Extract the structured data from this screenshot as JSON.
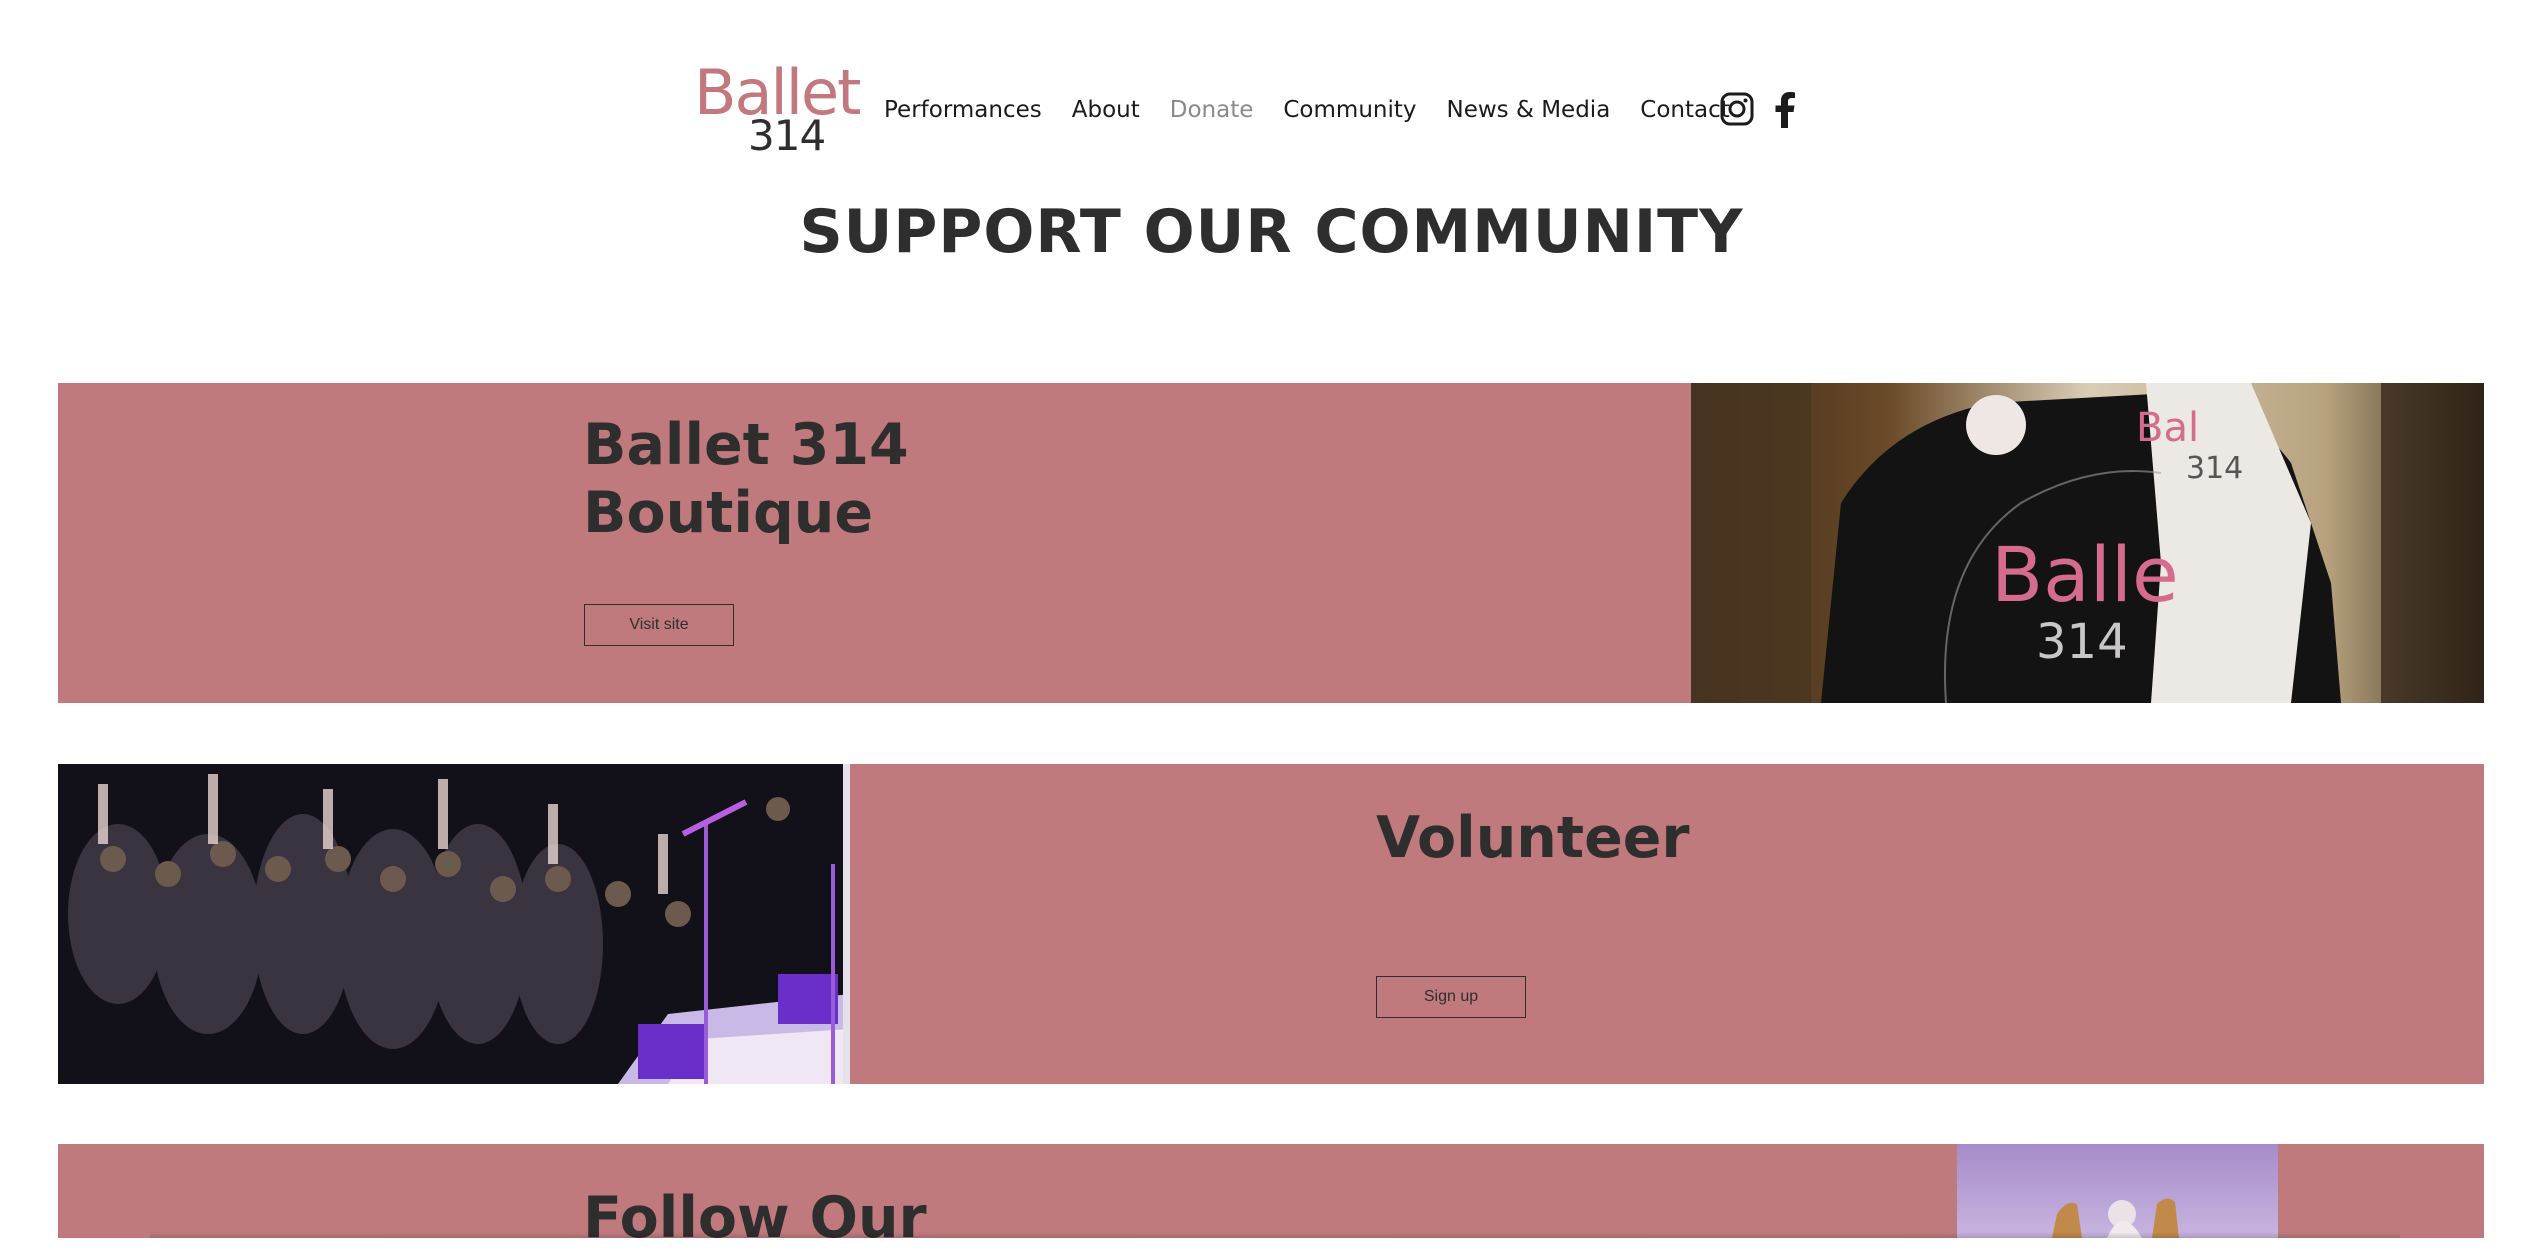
{
  "header": {
    "logo": {
      "line1": "Ballet",
      "line2": "314"
    },
    "nav": [
      {
        "label": "Performances",
        "active": false
      },
      {
        "label": "About",
        "active": false
      },
      {
        "label": "Donate",
        "active": true
      },
      {
        "label": "Community",
        "active": false
      },
      {
        "label": "News & Media",
        "active": false
      },
      {
        "label": "Contact",
        "active": false
      }
    ],
    "social": [
      "instagram-icon",
      "facebook-icon"
    ]
  },
  "page_title": "SUPPORT OUR COMMUNITY",
  "sections": [
    {
      "title_line1": "Ballet 314",
      "title_line2": "Boutique",
      "button": "Visit site"
    },
    {
      "title": "Volunteer",
      "button": "Sign up"
    },
    {
      "title": "Follow Our"
    }
  ],
  "colors": {
    "accent": "#c07a7e",
    "text": "#2f2e2e",
    "nav_active": "#8a8a8a",
    "logo_pink": "#c2787c"
  }
}
